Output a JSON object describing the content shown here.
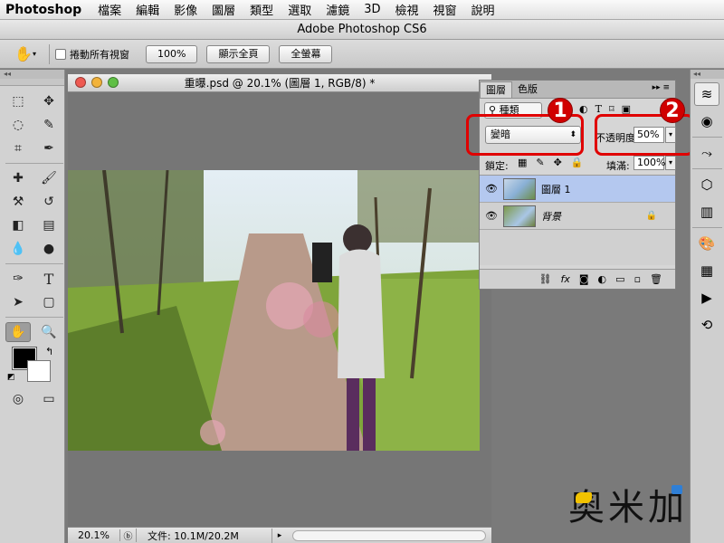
{
  "menubar": {
    "app": "Photoshop",
    "items": [
      "檔案",
      "編輯",
      "影像",
      "圖層",
      "類型",
      "選取",
      "濾鏡",
      "3D",
      "檢視",
      "視窗",
      "說明"
    ]
  },
  "app_title": "Adobe Photoshop CS6",
  "options": {
    "scroll_all_label": "捲動所有視窗",
    "zoom_100": "100%",
    "fit_screen": "顯示全頁",
    "fill_screen": "全螢幕"
  },
  "document": {
    "title": "重曝.psd @ 20.1% (圖層 1, RGB/8) *",
    "zoom": "20.1%",
    "info": "文件: 10.1M/20.2M"
  },
  "layers_panel": {
    "tabs": [
      "圖層",
      "色版"
    ],
    "kind_filter": "種類",
    "blend_mode": "變暗",
    "opacity_label": "不透明度:",
    "opacity_value": "50%",
    "lock_label": "鎖定:",
    "fill_label": "填滿:",
    "fill_value": "100%",
    "layers": [
      {
        "name": "圖層 1",
        "selected": true
      },
      {
        "name": "背景",
        "selected": false,
        "locked": true
      }
    ]
  },
  "annotations": {
    "badge1": "1",
    "badge2": "2",
    "color": "#e00000"
  },
  "watermark": "奥米加"
}
